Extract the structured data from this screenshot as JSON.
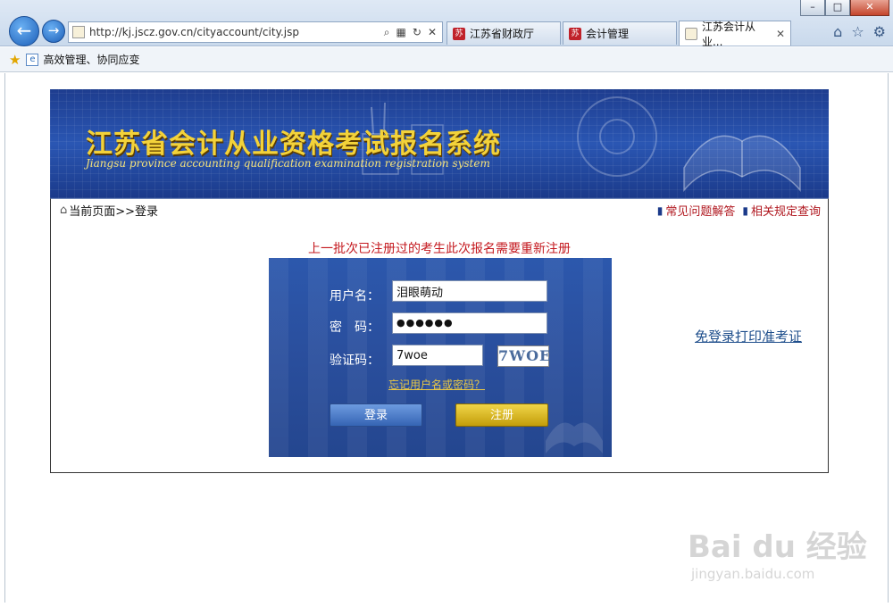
{
  "browser": {
    "url": "http://kj.jscz.gov.cn/cityaccount/city.jsp",
    "tabs": [
      {
        "label": "江苏省财政厅",
        "icon": "jscz-favicon"
      },
      {
        "label": "会计管理",
        "icon": "jscz-favicon"
      },
      {
        "label": "江苏会计从业...",
        "icon": "page-favicon",
        "active": true
      }
    ],
    "favorites": {
      "item": "高效管理、协同应变"
    }
  },
  "banner": {
    "title": "江苏省会计从业资格考试报名系统",
    "subtitle": "Jiangsu province accounting qualification examination registration system"
  },
  "breadcrumb": {
    "text": "当前页面>>登录",
    "links": [
      "常见问题解答",
      "相关规定查询"
    ]
  },
  "notice": "上一批次已注册过的考生此次报名需要重新注册",
  "login": {
    "username_label": "用户名：",
    "username_value": "泪眼萌动",
    "password_label": "密　码：",
    "password_value": "●●●●●●",
    "captcha_label": "验证码：",
    "captcha_value": "7woe",
    "captcha_image_text": "7WOE",
    "forgot_link": "忘记用户名或密码？",
    "login_button": "登录",
    "register_button": "注册"
  },
  "side_link": "免登录打印准考证",
  "watermark": {
    "main": "Bai du 经验",
    "sub": "jingyan.baidu.com"
  },
  "colors": {
    "banner_blue": "#1e3d8f",
    "title_yellow": "#f3d23a",
    "notice_red": "#c4191f",
    "link_red": "#b0171f"
  }
}
